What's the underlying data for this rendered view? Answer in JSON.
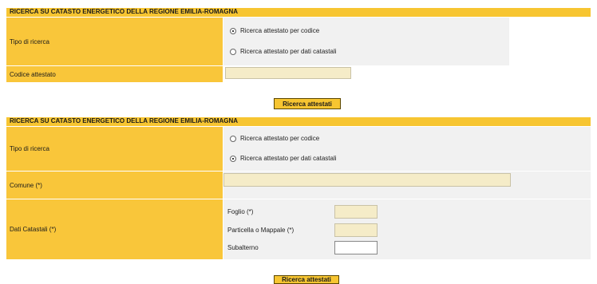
{
  "form1": {
    "header": "RICERCA SU CATASTO ENERGETICO DELLA REGIONE EMILIA-ROMAGNA",
    "tipo_label": "Tipo di ricerca",
    "radio_codice": "Ricerca attestato per codice",
    "radio_catastali": "Ricerca attestato per dati catastali",
    "selected": "codice",
    "codice_label": "Codice attestato",
    "codice_value": "",
    "button": "Ricerca attestati"
  },
  "form2": {
    "header": "RICERCA SU CATASTO ENERGETICO DELLA REGIONE EMILIA-ROMAGNA",
    "tipo_label": "Tipo di ricerca",
    "radio_codice": "Ricerca attestato per codice",
    "radio_catastali": "Ricerca attestato per dati catastali",
    "selected": "catastali",
    "comune_label": "Comune (*)",
    "comune_value": "",
    "dati_label": "Dati Catastali (*)",
    "foglio_label": "Foglio (*)",
    "foglio_value": "",
    "particella_label": "Particella o Mappale (*)",
    "particella_value": "",
    "subalterno_label": "Subalterno",
    "subalterno_value": "",
    "button": "Ricerca attestati"
  }
}
